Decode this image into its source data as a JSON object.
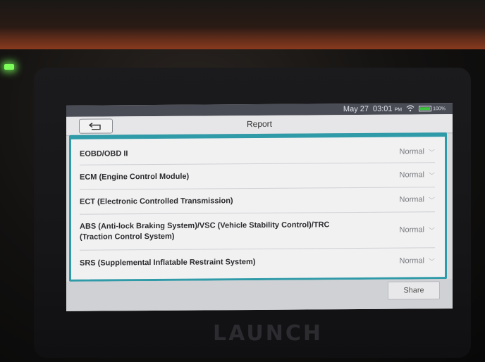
{
  "status_bar": {
    "date": "May 27",
    "time": "03:01",
    "ampm": "PM",
    "battery": "100%",
    "wifi_icon": "wifi-icon"
  },
  "header": {
    "title": "Report",
    "back_icon": "back-arrow-icon"
  },
  "report_rows": [
    {
      "label": "EOBD/OBD II",
      "status": "Normal"
    },
    {
      "label": "ECM (Engine Control Module)",
      "status": "Normal"
    },
    {
      "label": "ECT (Electronic Controlled Transmission)",
      "status": "Normal"
    },
    {
      "label": "ABS (Anti-lock Braking System)/VSC (Vehicle Stability Control)/TRC (Traction Control System)",
      "status": "Normal"
    },
    {
      "label": "SRS (Supplemental Inflatable Restraint System)",
      "status": "Normal"
    }
  ],
  "footer": {
    "share_label": "Share"
  },
  "device": {
    "brand": "LAUNCH"
  },
  "colors": {
    "panel_border": "#2f9aa8",
    "battery_fill": "#3ec43e",
    "status_bar": "#4a4c55"
  }
}
